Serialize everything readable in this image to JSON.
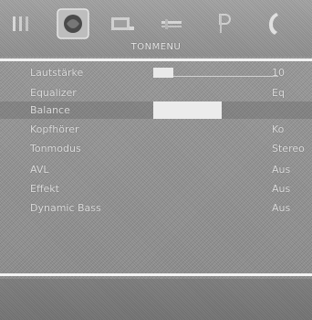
{
  "header": {
    "title": "TONMENU",
    "icons": [
      "picture-icon",
      "sound-icon",
      "channel-icon",
      "settings-icon",
      "parental-lock-icon",
      "phone-icon"
    ],
    "selected_icon": "sound-icon"
  },
  "menu": {
    "items": [
      {
        "label": "Lautstärke",
        "value": "10"
      },
      {
        "label": "Equalizer",
        "value": "Eq"
      },
      {
        "label": "Balance",
        "value": ""
      },
      {
        "label": "Kopfhörer",
        "value": "Ko"
      },
      {
        "label": "Tonmodus",
        "value": "Stereo"
      },
      {
        "label": "AVL",
        "value": "Aus"
      },
      {
        "label": "Effekt",
        "value": "Aus"
      },
      {
        "label": "Dynamic Bass",
        "value": "Aus"
      }
    ]
  },
  "colors": {
    "background": "#8d8d8d",
    "divider": "#f2f2f2",
    "text": "#dcdcdc"
  }
}
